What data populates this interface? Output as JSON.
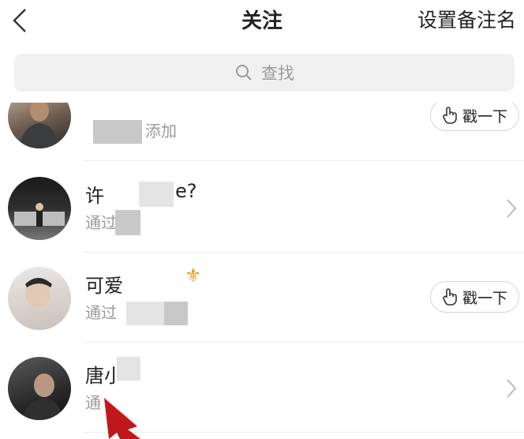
{
  "header": {
    "title": "关注",
    "remark_label": "设置备注名"
  },
  "search": {
    "placeholder": "查找"
  },
  "contacts": [
    {
      "name": "",
      "subtitle": "添加",
      "action": "戳一下",
      "icon": "hand-poke-icon"
    },
    {
      "name": "许",
      "name_suffix": "e?",
      "subtitle": "通过",
      "subtitle_suffix": "",
      "icon": "chevron-right-icon"
    },
    {
      "name": "可爱",
      "subtitle": "通过",
      "action": "戳一下",
      "icon": "hand-poke-icon"
    },
    {
      "name": "唐小",
      "subtitle": "通",
      "subtitle_suffix": "",
      "icon": "chevron-right-icon"
    }
  ],
  "colors": {
    "accent_arrow": "#c0171b",
    "mosaic": "#c8c8c8"
  }
}
